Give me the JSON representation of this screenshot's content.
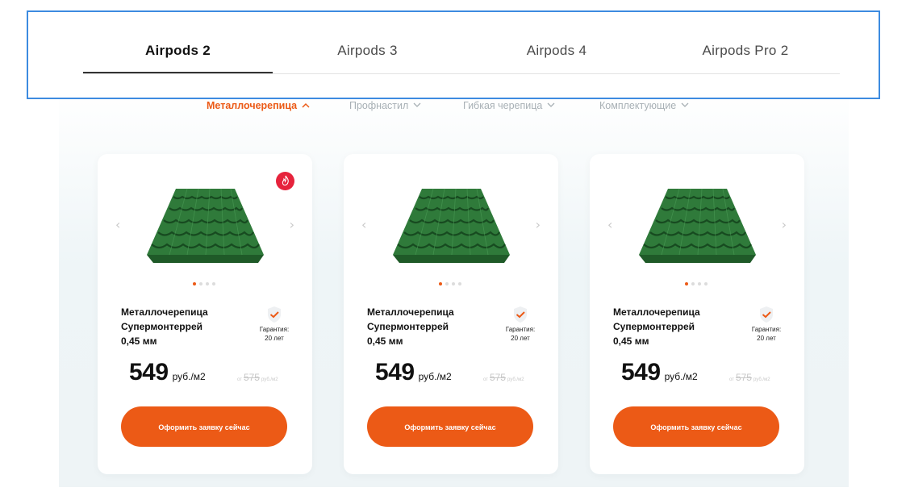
{
  "tabs": [
    {
      "label": "Airpods 2",
      "active": true
    },
    {
      "label": "Airpods 3",
      "active": false
    },
    {
      "label": "Airpods 4",
      "active": false
    },
    {
      "label": "Airpods Pro 2",
      "active": false
    }
  ],
  "categories": [
    {
      "label": "Металлочерепица",
      "active": true,
      "chevron": "chevron-up"
    },
    {
      "label": "Профнастил",
      "active": false,
      "chevron": "chevron-down"
    },
    {
      "label": "Гибкая черепица",
      "active": false,
      "chevron": "chevron-down"
    },
    {
      "label": "Комплектующие",
      "active": false,
      "chevron": "chevron-down"
    }
  ],
  "products": [
    {
      "title_line1": "Металлочерепица",
      "title_line2": "Супермонтеррей",
      "title_line3": "0,45 мм",
      "warranty_label": "Гарантия:",
      "warranty_value": "20 лет",
      "price": "549",
      "price_unit": "руб./м2",
      "old_prefix": "от",
      "old_price": "575",
      "old_unit": "руб./м2",
      "cta": "Оформить заявку сейчас",
      "has_badge": true,
      "slides": 4,
      "active_slide": 0
    },
    {
      "title_line1": "Металлочерепица",
      "title_line2": "Супермонтеррей",
      "title_line3": "0,45 мм",
      "warranty_label": "Гарантия:",
      "warranty_value": "20 лет",
      "price": "549",
      "price_unit": "руб./м2",
      "old_prefix": "от",
      "old_price": "575",
      "old_unit": "руб./м2",
      "cta": "Оформить заявку сейчас",
      "has_badge": false,
      "slides": 4,
      "active_slide": 0
    },
    {
      "title_line1": "Металлочерепица",
      "title_line2": "Супермонтеррей",
      "title_line3": "0,45 мм",
      "warranty_label": "Гарантия:",
      "warranty_value": "20 лет",
      "price": "549",
      "price_unit": "руб./м2",
      "old_prefix": "от",
      "old_price": "575",
      "old_unit": "руб./м2",
      "cta": "Оформить заявку сейчас",
      "has_badge": false,
      "slides": 4,
      "active_slide": 0
    }
  ],
  "icons": {
    "prev": "chevron-left-icon",
    "next": "chevron-right-icon",
    "badge": "flame-icon",
    "warranty": "shield-check-icon"
  },
  "colors": {
    "accent": "#ec5a16",
    "badge": "#e6233c",
    "tab_box_border": "#3d8be0",
    "roof_green": "#2f7a3a"
  }
}
